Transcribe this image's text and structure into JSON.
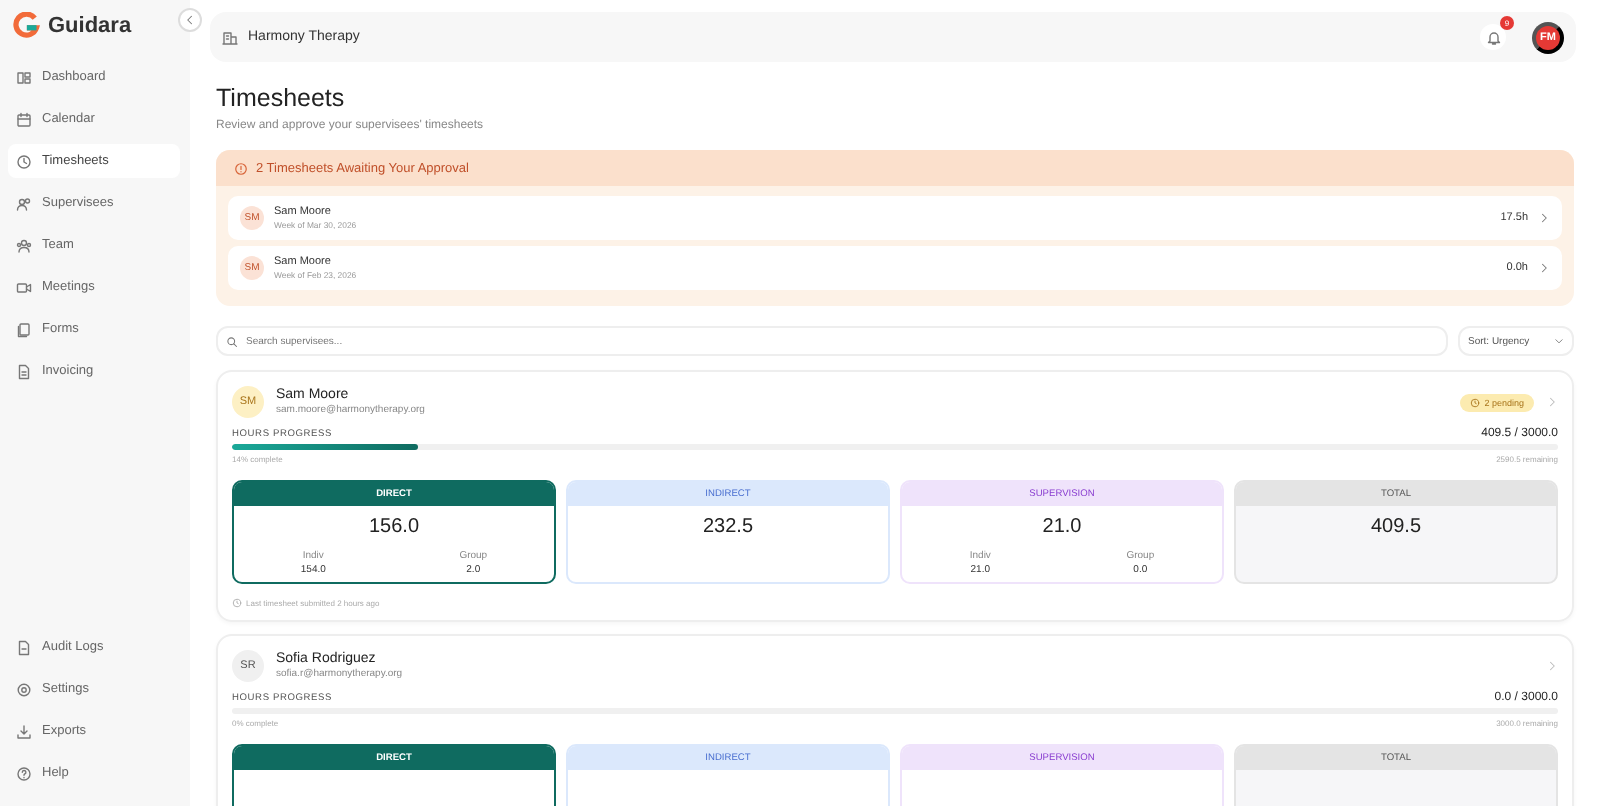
{
  "sidebar": {
    "brand": "Guidara",
    "items": [
      {
        "label": "Dashboard",
        "selected": false
      },
      {
        "label": "Calendar",
        "selected": false
      },
      {
        "label": "Timesheets",
        "selected": true
      },
      {
        "label": "Supervisees",
        "selected": false
      },
      {
        "label": "Team",
        "selected": false
      },
      {
        "label": "Meetings",
        "selected": false
      },
      {
        "label": "Forms",
        "selected": false
      },
      {
        "label": "Invoicing",
        "selected": false
      }
    ],
    "bottom_items": [
      {
        "label": "Audit Logs",
        "selected": false
      },
      {
        "label": "Settings",
        "selected": false
      },
      {
        "label": "Exports",
        "selected": false
      },
      {
        "label": "Help",
        "selected": false
      }
    ]
  },
  "header": {
    "organization": "Harmony Therapy",
    "notification_count": "9",
    "avatar": "FM"
  },
  "page": {
    "title": "Timesheets",
    "subtitle": "Review and approve your supervisees' timesheets"
  },
  "approval": {
    "title": "2 Timesheets Awaiting Your Approval",
    "items": [
      {
        "initials": "SM",
        "name": "Sam Moore",
        "week": "Week of Mar 30, 2026",
        "hours": "17.5h"
      },
      {
        "initials": "SM",
        "name": "Sam Moore",
        "week": "Week of Feb 23, 2026",
        "hours": "0.0h"
      }
    ]
  },
  "search": {
    "placeholder": "Search supervisees..."
  },
  "sort": {
    "value": "Sort: Urgency"
  },
  "supervisees": [
    {
      "initials": "SM",
      "color": "#fdf0c4",
      "name": "Sam Moore",
      "email": "sam.moore@harmonytherapy.org",
      "pending": "2 pending",
      "progress_label": "HOURS PROGRESS",
      "hours": "409.5 / 3000.0",
      "level": 0.14,
      "complete": "14% complete",
      "remaining": "2590.5 remaining",
      "stats": [
        {
          "kind": "direct",
          "label": "DIRECT",
          "value": "156.0",
          "breakdown": [
            {
              "label": "Indiv",
              "value": "154.0"
            },
            {
              "label": "Group",
              "value": "2.0"
            }
          ]
        },
        {
          "kind": "indirect",
          "label": "INDIRECT",
          "value": "232.5"
        },
        {
          "kind": "supervision",
          "label": "SUPERVISION",
          "value": "21.0",
          "breakdown": [
            {
              "label": "Indiv",
              "value": "21.0"
            },
            {
              "label": "Group",
              "value": "0.0"
            }
          ]
        },
        {
          "kind": "total",
          "label": "TOTAL",
          "value": "409.5"
        }
      ],
      "last_submitted": "Last timesheet submitted 2 hours ago"
    },
    {
      "initials": "SR",
      "color": "#f0f0f0",
      "name": "Sofia Rodriguez",
      "email": "sofia.r@harmonytherapy.org",
      "progress_label": "HOURS PROGRESS",
      "hours": "0.0 / 3000.0",
      "level": 0,
      "complete": "0% complete",
      "remaining": "3000.0 remaining",
      "stats": [
        {
          "kind": "direct",
          "label": "DIRECT"
        },
        {
          "kind": "indirect",
          "label": "INDIRECT"
        },
        {
          "kind": "supervision",
          "label": "SUPERVISION"
        },
        {
          "kind": "total",
          "label": "TOTAL"
        }
      ]
    }
  ]
}
